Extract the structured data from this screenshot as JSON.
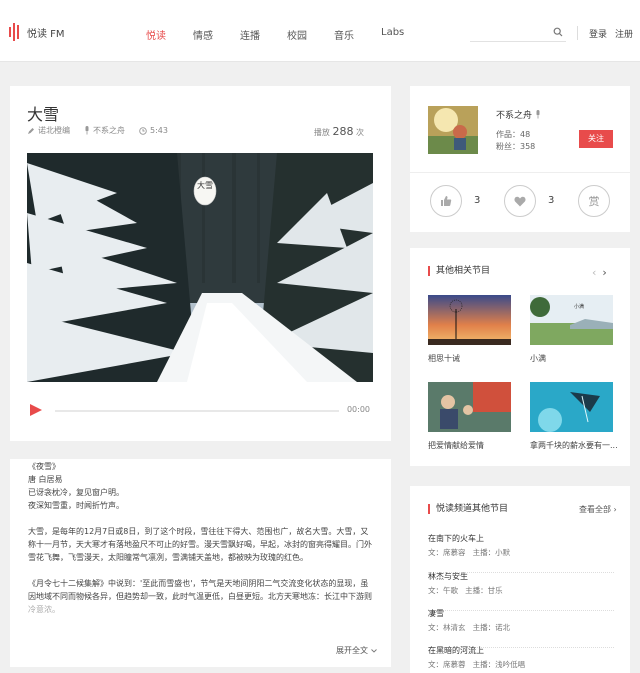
{
  "header": {
    "logo_text": "悦读 FM",
    "nav": [
      "悦读",
      "情感",
      "连播",
      "校园",
      "音乐",
      "Labs"
    ],
    "search_placeholder": "",
    "login": "登录",
    "register": "注册",
    "accent": "#e84b4b"
  },
  "episode": {
    "title": "大雪",
    "editor": "诺北橙编",
    "anchor": "不系之舟",
    "duration": "5:43",
    "plays_label": "播放",
    "plays": "288",
    "plays_unit": "次",
    "cover_stamp": "大雪",
    "player": {
      "time": "00:00",
      "progress": 0
    }
  },
  "text": {
    "lines": [
      "《夜雪》",
      "唐 白居易",
      "已讶衾枕冷，复见窗户明。",
      "夜深知雪重，时闻折竹声。",
      "",
      "大雪，是每年的12月7日或8日，到了这个时段，雪往往下得大、范围也广，故名大雪。大雪，又",
      "称十一月节，天大寒才有落地盈尺不可止的好雪。漫天雪飘好喝，早起，冰封的窗亮得耀目。门外",
      "雪花飞舞，飞雪漫天，太阳瞳常气凛冽，雪满铺天盖地，都被映为玫瑰的红色。",
      "",
      "《月令七十二候集解》中说到：'至此而雪盛也'，节气是天地间阴阳二气交流变化状态的显现，虽",
      "因地域不同而物候各异，但趋势却一致，此时气温更低，白昼更短。北方天寒地冻：长江中下游则",
      "冷意浓。"
    ],
    "expand": "展开全文"
  },
  "author": {
    "name": "不系之舟",
    "works_label": "作品：",
    "works": "48",
    "fans_label": "粉丝：",
    "fans": "358",
    "follow": "关注",
    "likes": "3",
    "favs": "3",
    "reward": "赏"
  },
  "related": {
    "title": "其他相关节目",
    "items": [
      {
        "caption": "相思十诫"
      },
      {
        "caption": "小满"
      },
      {
        "caption": "把爱情献给爱情"
      },
      {
        "caption": "拿两千块的薪水要有一..."
      }
    ]
  },
  "channel": {
    "title": "悦读频道其他节目",
    "see_all": "查看全部",
    "items": [
      {
        "name": "在南下的火车上",
        "author": "文：席慕容",
        "host": "主播：小默"
      },
      {
        "name": "林杰与安生",
        "author": "文：午歌",
        "host": "主播：甘乐"
      },
      {
        "name": "凄雪",
        "author": "文：林清玄",
        "host": "主播：诺北"
      },
      {
        "name": "在黑暗的河流上",
        "author": "文：席慕蓉",
        "host": "主播：浅吟低唱"
      }
    ]
  }
}
